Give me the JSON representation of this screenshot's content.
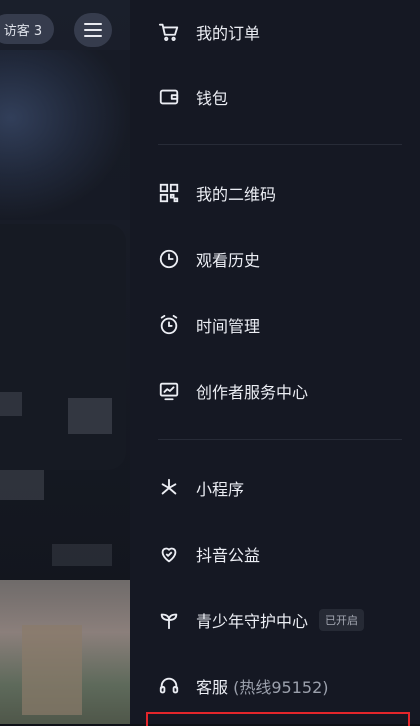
{
  "left_panel": {
    "visitor_label": "访客 3"
  },
  "menu_groups": [
    {
      "items": [
        {
          "label": "我的订单",
          "icon": "cart-icon"
        },
        {
          "label": "钱包",
          "icon": "wallet-icon"
        }
      ]
    },
    {
      "items": [
        {
          "label": "我的二维码",
          "icon": "qrcode-icon"
        },
        {
          "label": "观看历史",
          "icon": "clock-icon"
        },
        {
          "label": "时间管理",
          "icon": "alarm-icon"
        },
        {
          "label": "创作者服务中心",
          "icon": "chart-icon"
        }
      ]
    },
    {
      "items": [
        {
          "label": "小程序",
          "icon": "asterisk-icon"
        },
        {
          "label": "抖音公益",
          "icon": "heart-icon"
        },
        {
          "label": "青少年守护中心",
          "icon": "sprout-icon",
          "badge": "已开启"
        },
        {
          "label": "客服",
          "sub_label": "(热线95152)",
          "icon": "headset-icon"
        }
      ]
    }
  ],
  "colors": {
    "drawer_bg": "#151823",
    "text": "#eceef4",
    "divider": "#272b37",
    "highlight": "#e3262b"
  }
}
